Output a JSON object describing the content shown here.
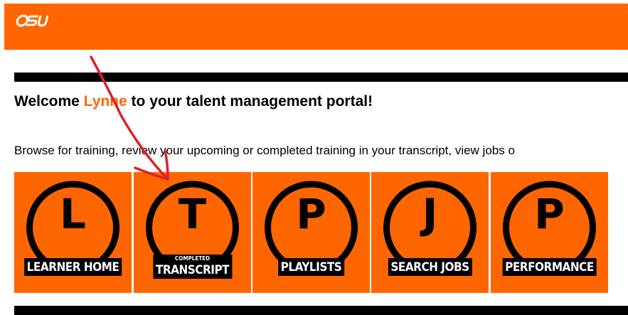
{
  "header": {
    "logo_text": "OSU",
    "brand_color": "#ff6600"
  },
  "welcome": {
    "prefix": "Welcome ",
    "user_name": "Lynne",
    "suffix": " to your talent management portal!"
  },
  "intro_text": "Browse for training, review your upcoming or completed training in your transcript, view jobs o",
  "tiles": [
    {
      "letter": "L",
      "label": "LEARNER HOME",
      "sublabel": ""
    },
    {
      "letter": "T",
      "label": "TRANSCRIPT",
      "sublabel": "COMPLETED"
    },
    {
      "letter": "P",
      "label": "PLAYLISTS",
      "sublabel": ""
    },
    {
      "letter": "J",
      "label": "SEARCH JOBS",
      "sublabel": ""
    },
    {
      "letter": "P",
      "label": "PERFORMANCE",
      "sublabel": ""
    }
  ],
  "annotation": {
    "type": "arrow",
    "color": "#e0202a",
    "points_to": "TRANSCRIPT"
  }
}
